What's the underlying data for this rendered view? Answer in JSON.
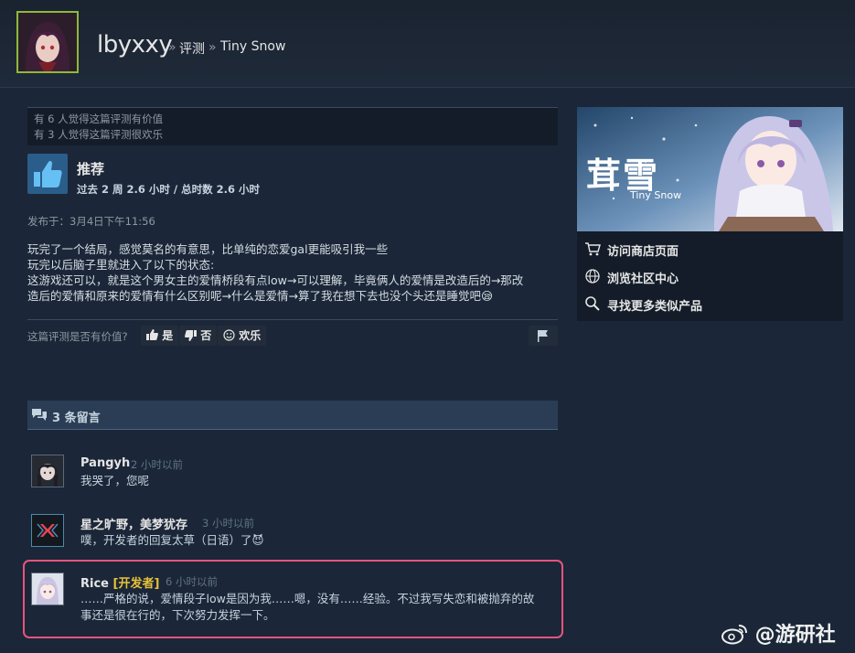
{
  "header": {
    "username": "lbyxxy",
    "separator": "»",
    "breadcrumb_reviews": "评测",
    "breadcrumb_game": "Tiny Snow"
  },
  "review": {
    "helpful_count_text": "有 6 人觉得这篇评测有价值",
    "funny_count_text": "有 3 人觉得这篇评测很欢乐",
    "verdict": "推荐",
    "hours": "过去 2 周 2.6 小时 / 总时数 2.6 小时",
    "posted": "发布于：3月4日下午11:56",
    "body_lines": [
      "玩完了一个结局，感觉莫名的有意思，比单纯的恋爱gal更能吸引我一些",
      "玩完以后脑子里就进入了以下的状态:",
      "这游戏还可以，就是这个男女主的爱情桥段有点low→可以理解，毕竟俩人的爱情是改造后的→那改",
      "造后的爱情和原来的爱情有什么区别呢→什么是爱情→算了我在想下去也没个头还是睡觉吧😪"
    ],
    "helpful_question": "这篇评测是否有价值?",
    "yes_label": "是",
    "no_label": "否",
    "funny_label": "欢乐"
  },
  "comments": {
    "title": "3 条留言",
    "items": [
      {
        "name": "Pangyh",
        "time": "2 小时以前",
        "text": "我哭了，您呢"
      },
      {
        "name": "星之旷野，美梦犹存",
        "time": "3 小时以前",
        "text": "噗，开发者的回复太草（日语）了😈"
      },
      {
        "name": "Rice",
        "dev_tag": "[开发者]",
        "time": "6 小时以前",
        "text_line1": "……严格的说，爱情段子low是因为我……嗯，没有……经验。不过我写失恋和被抛弃的故",
        "text_line2": "事还是很在行的，下次努力发挥一下。"
      }
    ]
  },
  "sidebar": {
    "banner_title": "茸雪",
    "banner_subtitle": "Tiny Snow",
    "links": [
      "访问商店页面",
      "浏览社区中心",
      "寻找更多类似产品"
    ]
  },
  "watermark": "@游研社",
  "colors": {
    "background": "#1b2738",
    "highlight_border": "#e8537d",
    "developer_tag": "#e6c13a",
    "avatar_border": "#8fb93b"
  }
}
